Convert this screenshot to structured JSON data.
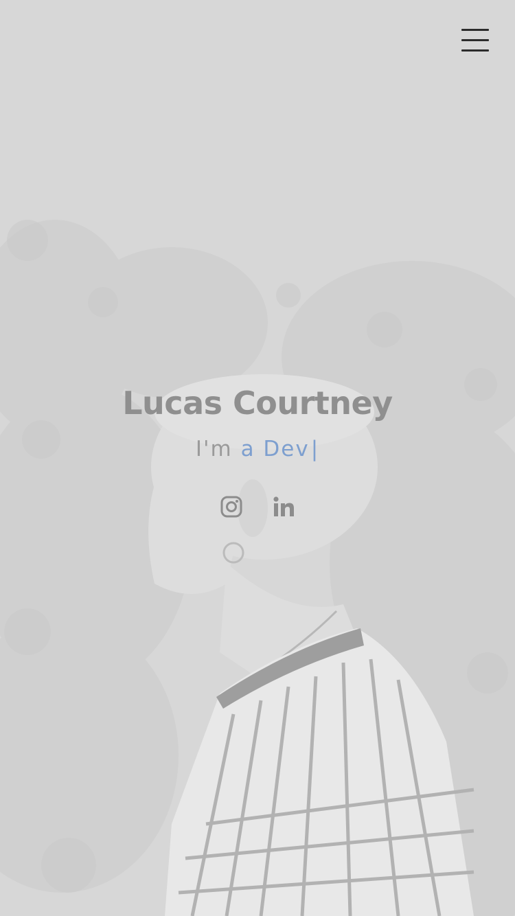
{
  "hero": {
    "name": "Lucas Courtney",
    "tagline_prefix": "I'm",
    "tagline_typed": "a Dev",
    "cursor": "|"
  },
  "menu": {
    "icon": "hamburger-menu-icon"
  },
  "socials": [
    {
      "icon": "instagram-icon"
    },
    {
      "icon": "linkedin-icon"
    }
  ],
  "colors": {
    "background": "#d6d6d6",
    "name": "#8f8f8f",
    "tagline": "#9a9a9a",
    "accent": "#7d9fcf",
    "menu_icon": "#2b2b2b",
    "social_icon": "#8c8c8c"
  }
}
